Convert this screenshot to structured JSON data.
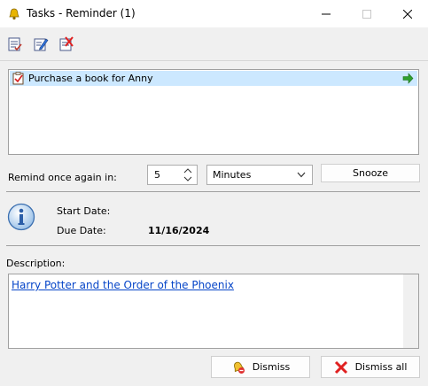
{
  "window": {
    "title": "Tasks - Reminder (1)"
  },
  "toolbar": {
    "icons": [
      "open-task-icon",
      "edit-task-icon",
      "delete-task-icon"
    ]
  },
  "tasks": [
    {
      "label": "Purchase a book for Anny"
    }
  ],
  "remind": {
    "label": "Remind once again in:",
    "amount": "5",
    "unit": "Minutes",
    "snooze_label": "Snooze"
  },
  "details": {
    "start_label": "Start Date:",
    "due_label": "Due Date:",
    "due_value": "11/16/2024"
  },
  "description": {
    "label": "Description:",
    "link_text": "Harry Potter and the Order of the Phoenix"
  },
  "buttons": {
    "dismiss": "Dismiss",
    "dismiss_all": "Dismiss all"
  },
  "colors": {
    "selection": "#cce8ff",
    "link": "#0645c8",
    "arrow_green": "#2ea02e"
  }
}
